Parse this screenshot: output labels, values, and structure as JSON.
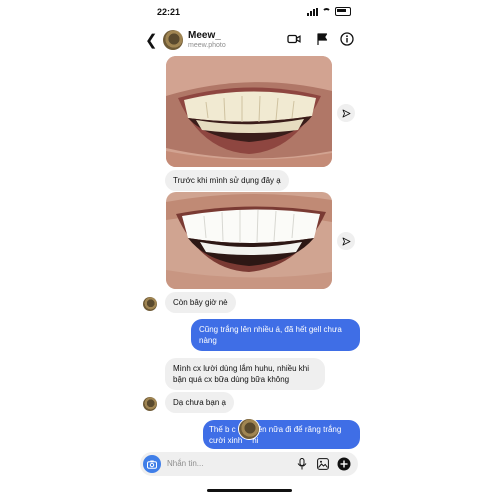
{
  "status_bar": {
    "time": "22:21"
  },
  "header": {
    "name": "Meew_",
    "username": "meew.photo"
  },
  "messages": {
    "m1": "Trước khi mình sử dụng đây ạ",
    "m2": "Còn bây giờ nè",
    "m3": "Cũng trắng lên nhiều á, đã hết gell chưa nàng",
    "m4": "Mình cx lười dùng lắm huhu, nhiều khi bận quá cx bữa dùng bữa không",
    "m5": "Dạ chưa bạn ạ",
    "m6_part1": "Thế b c",
    "m6_part2": "ên nữa đi để răng trắng",
    "m6_part3": "cười xinh",
    "m6_part4": "hi"
  },
  "composer": {
    "placeholder": "Nhắn tin..."
  },
  "colors": {
    "outgoing_bubble": "#3f6ee6",
    "incoming_bubble": "#efefef",
    "camera_button": "#3f7ee8"
  },
  "icons": [
    "back-arrow-icon",
    "video-call-icon",
    "flag-icon",
    "info-icon",
    "share-icon",
    "camera-icon",
    "microphone-icon",
    "gallery-icon",
    "plus-icon"
  ]
}
